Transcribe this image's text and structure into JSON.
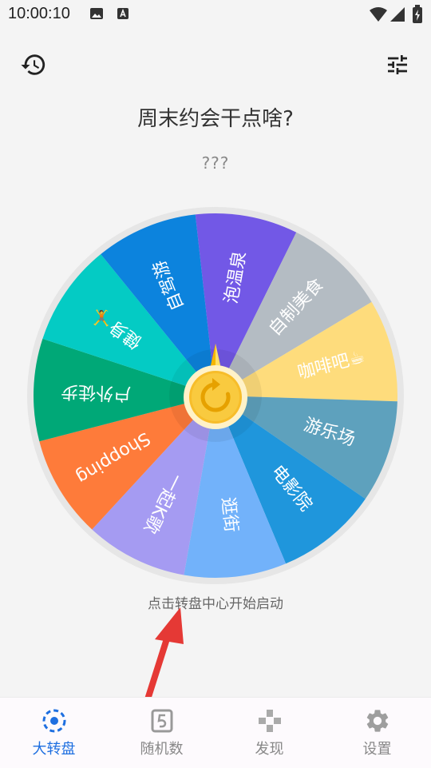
{
  "status_bar": {
    "time": "10:00:10",
    "left_icons": [
      "image-icon",
      "text-notification-icon"
    ],
    "right_icons": [
      "wifi-icon",
      "signal-icon",
      "battery-icon"
    ]
  },
  "header": {
    "history_icon": "history-icon",
    "settings_icon": "tune-icon"
  },
  "title": "周末约会干点啥?",
  "result": "???",
  "wheel": {
    "center_icon": "refresh-icon",
    "segments": [
      {
        "label": "泡温泉",
        "color": "#7258e6"
      },
      {
        "label": "自制美食",
        "color": "#b4bcc3"
      },
      {
        "label": "咖啡吧☕",
        "color": "#fedc7c"
      },
      {
        "label": "游乐场",
        "color": "#5ea1bd"
      },
      {
        "label": "电影院",
        "color": "#1f96dc"
      },
      {
        "label": "逛街",
        "color": "#72b2fa"
      },
      {
        "label": "一起K歌",
        "color": "#a59bf2"
      },
      {
        "label": "Shopping",
        "color": "#fe7b3a"
      },
      {
        "label": "户外徒步",
        "color": "#00a877"
      },
      {
        "label": "健身🤸",
        "color": "#04cbc4"
      },
      {
        "label": "自驾游",
        "color": "#0c83dd"
      }
    ]
  },
  "hint": "点击转盘中心开始启动",
  "bottom_nav": [
    {
      "label": "大转盘",
      "icon": "wheel-icon",
      "active": true
    },
    {
      "label": "随机数",
      "icon": "number-five-icon",
      "active": false
    },
    {
      "label": "发现",
      "icon": "gamepad-icon",
      "active": false
    },
    {
      "label": "设置",
      "icon": "gear-icon",
      "active": false
    }
  ],
  "colors": {
    "accent": "#1e6fe0",
    "annotation_arrow": "#e53935",
    "pointer_gold": "#f5b700"
  }
}
